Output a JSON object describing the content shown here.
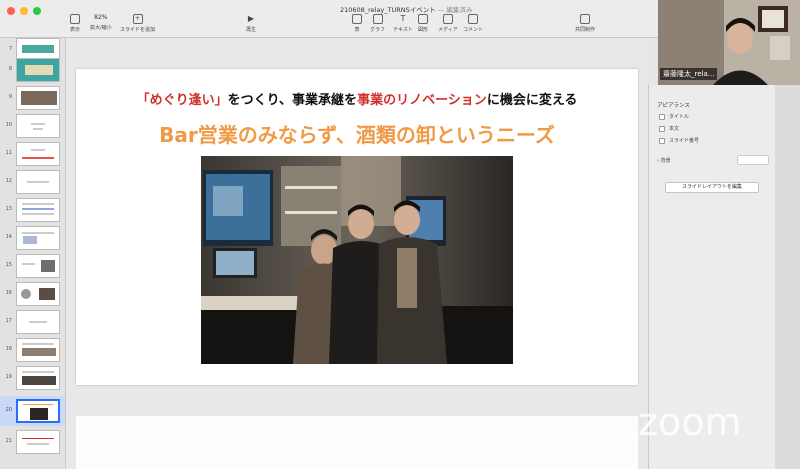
{
  "window": {
    "title": "210608_relay_TURNSイベント",
    "status": "— 編集済み"
  },
  "toolbar": {
    "zoom_value": "82%",
    "items": {
      "view": "表示",
      "zoom": "拡大/縮小",
      "add_slide": "スライドを追加",
      "play": "再生",
      "table": "表",
      "chart": "グラフ",
      "text": "テキスト",
      "shape": "図形",
      "media": "メディア",
      "comment": "コメント",
      "collaborate": "共同制作"
    }
  },
  "navigator": {
    "slide_numbers": [
      "7",
      "8",
      "9",
      "10",
      "11",
      "12",
      "13",
      "14",
      "15",
      "16",
      "17",
      "18",
      "19",
      "20",
      "21"
    ],
    "selected": "20"
  },
  "slide": {
    "heading_quote": "「めぐり逢い」",
    "heading_mid": "をつくり、事業承継を",
    "heading_red2": "事業のリノベーション",
    "heading_end": "に機会に変える",
    "subheading": "Bar営業のみならず、酒類の卸というニーズ"
  },
  "inspector": {
    "section": "アピアランス",
    "checks": [
      "タイトル",
      "本文",
      "スライド番号"
    ],
    "background_label": "背景",
    "edit_layout_button": "スライドレイアウトを編集"
  },
  "participant": {
    "name": "齋藤隆太_rela..."
  },
  "watermark": "zoom",
  "colors": {
    "accent_red": "#d0312d",
    "accent_orange": "#ef9a45",
    "selection_blue": "#2a6ef5"
  }
}
